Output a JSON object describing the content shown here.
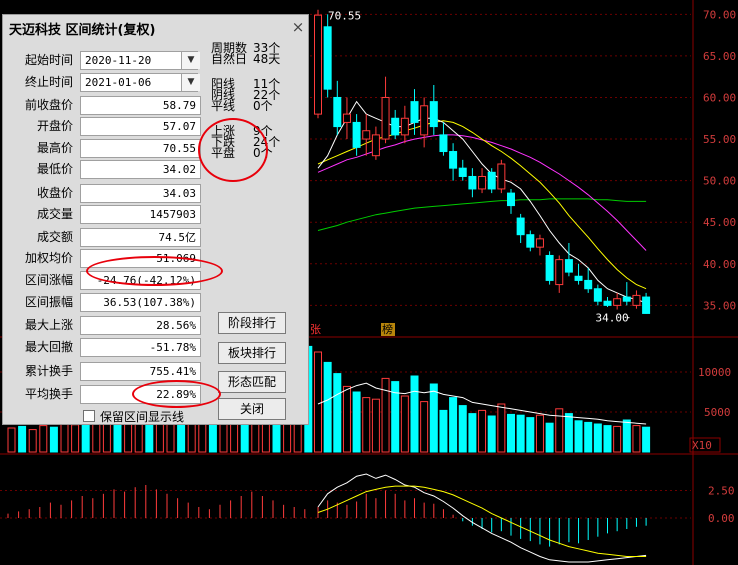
{
  "colors": {
    "background": "#000000",
    "up": "#ff3b3b",
    "down": "#00ffff",
    "ma5": "#ffffff",
    "ma10": "#ffff00",
    "ma20": "#ff33ff",
    "ma60": "#00cc00",
    "axis_text": "#d23c3c",
    "annotation": "#e8000b"
  },
  "dialog": {
    "title": "天迈科技 区间统计(复权)",
    "close_icon": "×",
    "rows": [
      {
        "label": "起始时间",
        "value": "2020-11-20"
      },
      {
        "label": "终止时间",
        "value": "2021-01-06"
      },
      {
        "label": "前收盘价",
        "value": "58.79"
      },
      {
        "label": "开盘价",
        "value": "57.07"
      },
      {
        "label": "最高价",
        "value": "70.55"
      },
      {
        "label": "最低价",
        "value": "34.02"
      },
      {
        "label": "收盘价",
        "value": "34.03"
      },
      {
        "label": "成交量",
        "value": "1457903"
      },
      {
        "label": "成交额",
        "value": "74.5亿"
      },
      {
        "label": "加权均价",
        "value": "51.069"
      },
      {
        "label": "区间涨幅",
        "value": "-24.76(-42.12%)"
      },
      {
        "label": "区间振幅",
        "value": "36.53(107.38%)"
      },
      {
        "label": "最大上涨",
        "value": "28.56%"
      },
      {
        "label": "最大回撤",
        "value": "-51.78%"
      },
      {
        "label": "累计换手",
        "value": "755.41%"
      },
      {
        "label": "平均换手",
        "value": "22.89%"
      }
    ],
    "stats": [
      {
        "label": "周期数",
        "value": "33个"
      },
      {
        "label": "自然日",
        "value": "48天"
      },
      {
        "label": "阳线",
        "value": "11个"
      },
      {
        "label": "阴线",
        "value": "22个"
      },
      {
        "label": "平线",
        "value": "0个"
      },
      {
        "label": "上涨",
        "value": "9个"
      },
      {
        "label": "下跌",
        "value": "24个"
      },
      {
        "label": "平盘",
        "value": "0个"
      }
    ],
    "buttons": {
      "stage_rank": "阶段排行",
      "sector_rank": "板块排行",
      "pattern_match": "形态匹配",
      "close": "关闭"
    },
    "checkbox_label": "保留区间显示线"
  },
  "chart_data": {
    "type": "candlestick",
    "price_axis": {
      "ticks": [
        "70.00",
        "65.00",
        "60.00",
        "55.00",
        "50.00",
        "45.00",
        "40.00",
        "35.00"
      ],
      "range": [
        33.0,
        71.0
      ]
    },
    "volume_axis": {
      "ticks": [
        "10000",
        "5000"
      ],
      "unit_label": "X10",
      "range": [
        0,
        14000
      ]
    },
    "macd_axis": {
      "ticks": [
        "2.50",
        "0.00"
      ]
    },
    "max_label": "70.55",
    "min_label": "34.00",
    "markers": [
      "张",
      "榜"
    ],
    "candles": [
      {
        "o": 58.0,
        "c": 69.9,
        "h": 70.55,
        "l": 57.5
      },
      {
        "o": 68.5,
        "c": 61.0,
        "h": 70.0,
        "l": 60.0
      },
      {
        "o": 60.0,
        "c": 56.5,
        "h": 62.0,
        "l": 55.5
      },
      {
        "o": 57.0,
        "c": 58.0,
        "h": 60.0,
        "l": 55.0
      },
      {
        "o": 57.0,
        "c": 54.0,
        "h": 58.0,
        "l": 53.0
      },
      {
        "o": 55.0,
        "c": 56.0,
        "h": 58.0,
        "l": 53.0
      },
      {
        "o": 53.0,
        "c": 55.5,
        "h": 56.5,
        "l": 52.5
      },
      {
        "o": 55.0,
        "c": 60.0,
        "h": 62.5,
        "l": 54.5
      },
      {
        "o": 57.5,
        "c": 55.5,
        "h": 58.5,
        "l": 55.0
      },
      {
        "o": 55.5,
        "c": 57.5,
        "h": 59.0,
        "l": 54.5
      },
      {
        "o": 59.5,
        "c": 57.0,
        "h": 61.0,
        "l": 55.5
      },
      {
        "o": 55.5,
        "c": 59.0,
        "h": 60.0,
        "l": 54.0
      },
      {
        "o": 59.5,
        "c": 56.5,
        "h": 61.5,
        "l": 55.5
      },
      {
        "o": 55.5,
        "c": 53.5,
        "h": 57.0,
        "l": 53.0
      },
      {
        "o": 53.5,
        "c": 51.5,
        "h": 54.5,
        "l": 50.0
      },
      {
        "o": 51.5,
        "c": 50.5,
        "h": 52.5,
        "l": 50.0
      },
      {
        "o": 50.5,
        "c": 49.0,
        "h": 51.5,
        "l": 48.0
      },
      {
        "o": 49.0,
        "c": 50.5,
        "h": 51.5,
        "l": 48.5
      },
      {
        "o": 51.0,
        "c": 49.0,
        "h": 51.5,
        "l": 48.5
      },
      {
        "o": 49.0,
        "c": 52.0,
        "h": 52.5,
        "l": 48.5
      },
      {
        "o": 48.5,
        "c": 47.0,
        "h": 49.0,
        "l": 46.0
      },
      {
        "o": 45.5,
        "c": 43.5,
        "h": 46.0,
        "l": 42.5
      },
      {
        "o": 43.5,
        "c": 42.0,
        "h": 44.0,
        "l": 41.5
      },
      {
        "o": 42.0,
        "c": 43.0,
        "h": 43.5,
        "l": 41.0
      },
      {
        "o": 41.0,
        "c": 38.0,
        "h": 41.5,
        "l": 37.5
      },
      {
        "o": 37.5,
        "c": 40.5,
        "h": 41.0,
        "l": 36.5
      },
      {
        "o": 40.5,
        "c": 39.0,
        "h": 42.5,
        "l": 38.5
      },
      {
        "o": 38.5,
        "c": 38.0,
        "h": 40.0,
        "l": 37.5
      },
      {
        "o": 38.0,
        "c": 37.0,
        "h": 39.5,
        "l": 36.5
      },
      {
        "o": 37.0,
        "c": 35.5,
        "h": 37.5,
        "l": 35.0
      },
      {
        "o": 35.5,
        "c": 35.0,
        "h": 36.0,
        "l": 34.8
      },
      {
        "o": 35.0,
        "c": 35.8,
        "h": 36.5,
        "l": 34.5
      },
      {
        "o": 36.0,
        "c": 35.5,
        "h": 37.8,
        "l": 35.0
      },
      {
        "o": 35.0,
        "c": 36.2,
        "h": 36.8,
        "l": 34.6
      },
      {
        "o": 36.0,
        "c": 34.03,
        "h": 36.5,
        "l": 34.0
      }
    ],
    "ma5": [
      51.5,
      53.0,
      55.5,
      57.5,
      59.5,
      58.0,
      57.5,
      57.0,
      56.5,
      56.5,
      57.0,
      57.5,
      57.5,
      57.0,
      56.0,
      55.0,
      53.5,
      52.0,
      50.8,
      50.2,
      49.8,
      49.0,
      47.5,
      45.8,
      44.0,
      42.5,
      41.2,
      40.5,
      39.5,
      38.0,
      37.0,
      36.5,
      36.0,
      35.7,
      35.3
    ],
    "ma10": [
      52.0,
      52.5,
      53.0,
      53.5,
      54.0,
      54.5,
      55.0,
      55.3,
      55.6,
      56.0,
      56.3,
      56.7,
      57.0,
      57.2,
      57.0,
      56.5,
      55.8,
      55.0,
      54.2,
      53.5,
      52.7,
      51.8,
      50.8,
      49.8,
      48.6,
      47.3,
      45.8,
      44.5,
      43.2,
      41.8,
      40.5,
      39.3,
      38.3,
      37.5,
      37.0
    ],
    "ma20": [
      51.0,
      51.5,
      52.0,
      52.5,
      52.8,
      53.2,
      53.6,
      54.0,
      54.3,
      54.7,
      55.0,
      55.2,
      55.4,
      55.5,
      55.5,
      55.4,
      55.2,
      54.9,
      54.6,
      54.2,
      53.8,
      53.3,
      52.8,
      52.2,
      51.5,
      50.8,
      50.0,
      49.2,
      48.3,
      47.3,
      46.3,
      45.2,
      44.0,
      42.8,
      41.6
    ],
    "ma60": [
      44.0,
      44.3,
      44.6,
      45.0,
      45.3,
      45.6,
      45.9,
      46.1,
      46.3,
      46.5,
      46.7,
      46.8,
      46.9,
      47.0,
      47.1,
      47.2,
      47.3,
      47.4,
      47.5,
      47.6,
      47.6,
      47.7,
      47.7,
      47.7,
      47.8,
      47.8,
      47.8,
      47.8,
      47.8,
      47.7,
      47.7,
      47.6,
      47.5,
      47.5,
      47.5
    ],
    "volumes": [
      12500,
      11200,
      9800,
      8200,
      7500,
      6800,
      6600,
      9200,
      8800,
      7000,
      9500,
      6300,
      8500,
      5200,
      6800,
      5800,
      4800,
      5200,
      4500,
      6000,
      4700,
      4600,
      4300,
      4600,
      3600,
      5400,
      4800,
      3900,
      3700,
      3500,
      3300,
      3200,
      4000,
      3300,
      3100
    ],
    "vol_ma": [
      6000,
      6500,
      7200,
      7800,
      8300,
      8600,
      8000,
      7700,
      7400,
      7300,
      7600,
      7400,
      7600,
      7200,
      7000,
      6800,
      6200,
      6000,
      5800,
      5600,
      5400,
      5200,
      5000,
      4800,
      4600,
      4500,
      4400,
      4300,
      4200,
      4100,
      3900,
      3800,
      3700,
      3600,
      3500
    ],
    "macd_hist": [
      1.0,
      1.6,
      1.4,
      1.2,
      1.5,
      2.2,
      1.8,
      2.5,
      2.2,
      1.6,
      1.8,
      1.4,
      1.3,
      0.8,
      0.3,
      -0.3,
      -0.7,
      -1.0,
      -1.3,
      -1.2,
      -1.6,
      -1.9,
      -2.1,
      -2.4,
      -2.6,
      -2.4,
      -2.2,
      -2.3,
      -2.0,
      -1.7,
      -1.4,
      -1.2,
      -1.0,
      -0.8,
      -0.7
    ],
    "dif": [
      1.0,
      2.2,
      2.8,
      3.2,
      3.8,
      4.0,
      3.6,
      3.9,
      3.5,
      3.0,
      2.8,
      2.3,
      2.0,
      1.5,
      0.9,
      0.2,
      -0.4,
      -0.9,
      -1.4,
      -1.8,
      -2.2,
      -2.7,
      -3.1,
      -3.5,
      -3.8,
      -3.9,
      -4.0,
      -4.0,
      -4.0,
      -3.9,
      -3.8,
      -3.7,
      -3.6,
      -3.5,
      -3.4
    ],
    "dea": [
      0.5,
      0.8,
      1.2,
      1.6,
      2.0,
      2.4,
      2.6,
      2.8,
      2.9,
      2.9,
      2.9,
      2.8,
      2.6,
      2.4,
      2.1,
      1.7,
      1.3,
      0.9,
      0.4,
      0.0,
      -0.4,
      -0.8,
      -1.2,
      -1.6,
      -2.0,
      -2.3,
      -2.6,
      -2.8,
      -3.0,
      -3.2,
      -3.3,
      -3.4,
      -3.5,
      -3.5,
      -3.5
    ]
  }
}
